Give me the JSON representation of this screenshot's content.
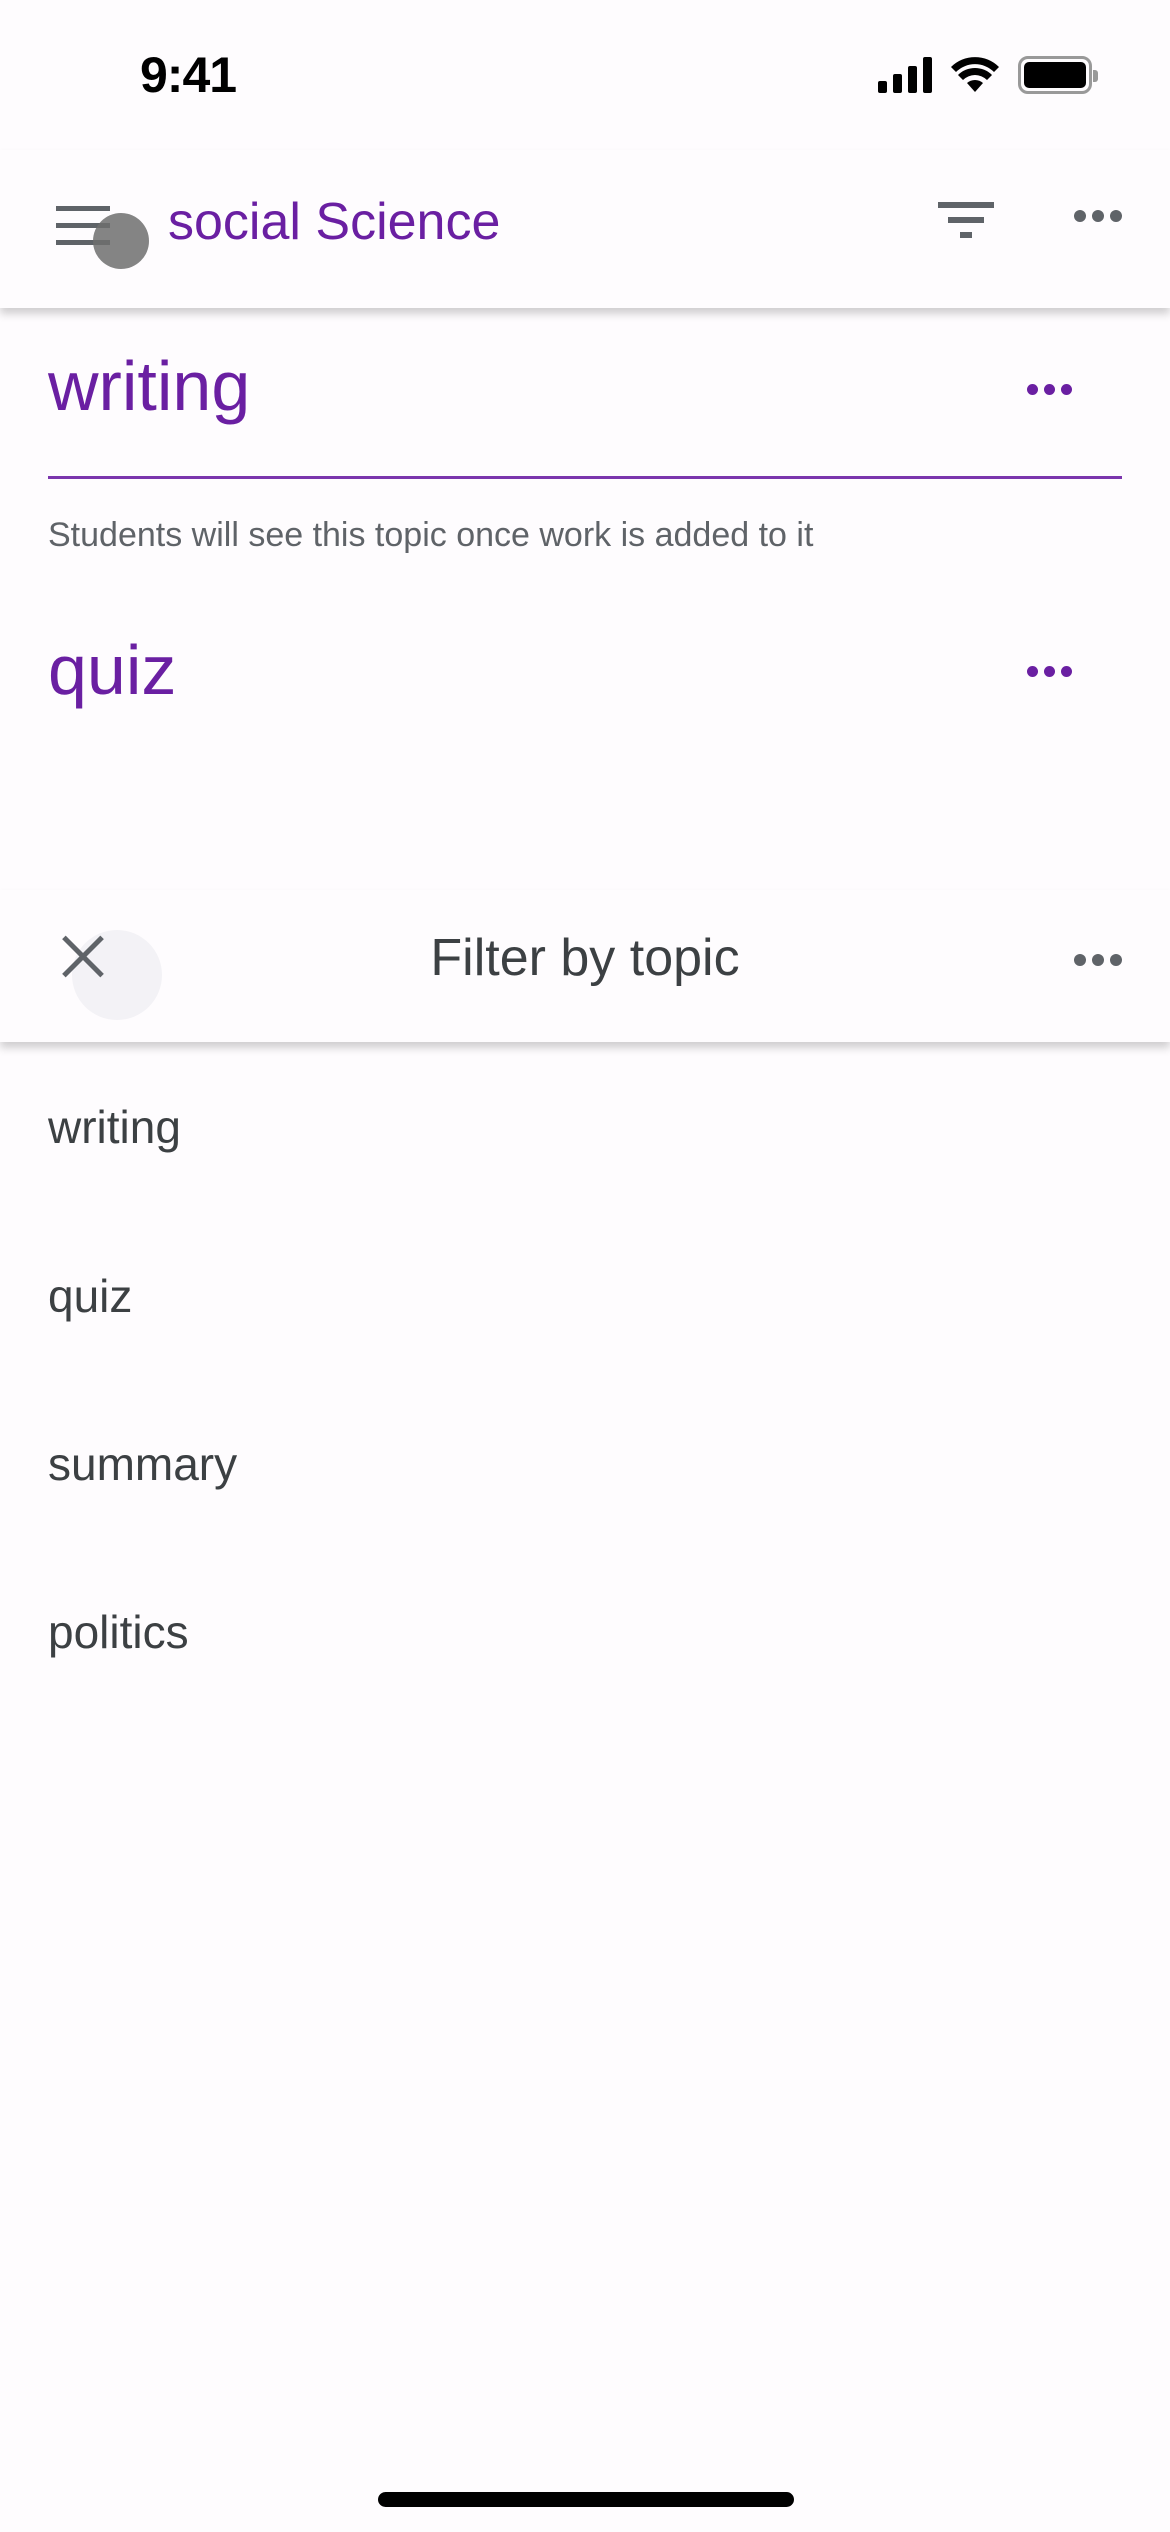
{
  "status_bar": {
    "time": "9:41",
    "icons": [
      "cellular-signal-icon",
      "wifi-icon",
      "battery-icon"
    ]
  },
  "app_bar": {
    "title": "social Science",
    "menu_icon": "hamburger-menu-icon",
    "filter_icon": "filter-icon",
    "more_icon": "more-horizontal-icon"
  },
  "topics": [
    {
      "title": "writing",
      "hint": "Students will see this topic once work is added to it",
      "more_icon": "more-horizontal-icon"
    },
    {
      "title": "quiz",
      "more_icon": "more-horizontal-icon"
    }
  ],
  "filter_sheet": {
    "title": "Filter by topic",
    "close_icon": "close-icon",
    "more_icon": "more-horizontal-icon",
    "options": [
      "writing",
      "quiz",
      "summary",
      "politics"
    ]
  },
  "colors": {
    "accent": "#6a1fa2",
    "divider": "#7b35ad",
    "icon_gray": "#5f6368",
    "text_dark": "#3c4043",
    "background": "#fefcfe"
  }
}
